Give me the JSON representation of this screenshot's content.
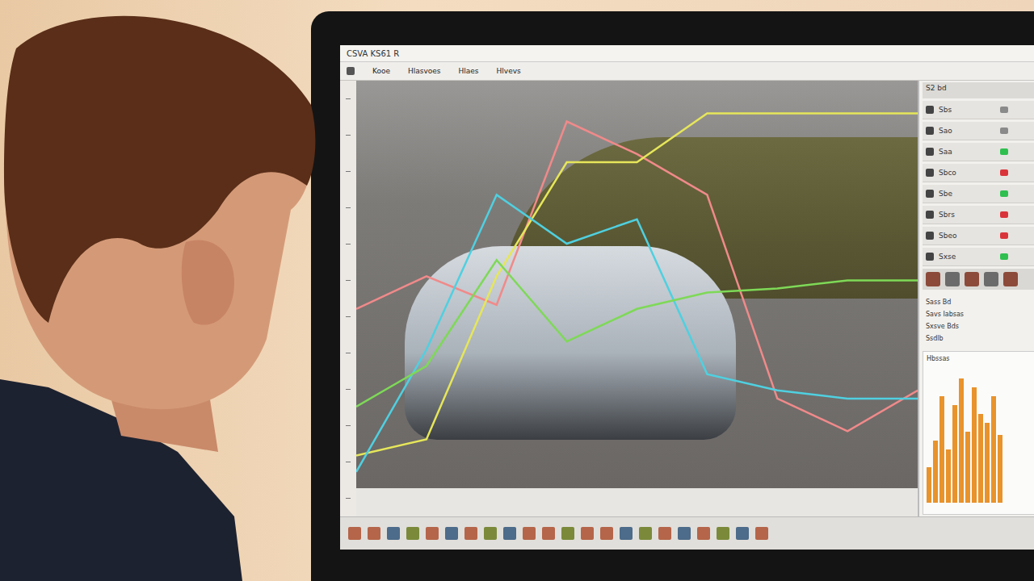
{
  "window": {
    "title": "CSVA KS61 R"
  },
  "menu": [
    {
      "label": "Kooe"
    },
    {
      "label": "Hlasvoes"
    },
    {
      "label": "Hlaes"
    },
    {
      "label": "Hlvevs"
    }
  ],
  "chart": {
    "series": [
      {
        "name": "pink",
        "color": "#f08a8a",
        "values": [
          44,
          52,
          45,
          90,
          82,
          72,
          22,
          14,
          24
        ]
      },
      {
        "name": "yellow",
        "color": "#e6e65a",
        "values": [
          8,
          12,
          52,
          80,
          80,
          92,
          92,
          92,
          92
        ]
      },
      {
        "name": "cyan",
        "color": "#4fd0e0",
        "values": [
          4,
          34,
          72,
          60,
          66,
          28,
          24,
          22,
          22
        ]
      },
      {
        "name": "green",
        "color": "#7ed957",
        "values": [
          20,
          30,
          56,
          36,
          44,
          48,
          49,
          51,
          51
        ]
      }
    ]
  },
  "panel": {
    "header": "S2 bd",
    "rows": [
      {
        "label": "Sbs",
        "color": "#8a8a8a"
      },
      {
        "label": "Sao",
        "color": "#8a8a8a"
      },
      {
        "label": "Saa",
        "color": "#2fbf4f"
      },
      {
        "label": "Sbco",
        "color": "#d9343a"
      },
      {
        "label": "Sbe",
        "color": "#2fbf4f"
      },
      {
        "label": "Sbrs",
        "color": "#d9343a"
      },
      {
        "label": "Sbeo",
        "color": "#d9343a"
      },
      {
        "label": "Sxse",
        "color": "#2fbf4f"
      }
    ],
    "notes": [
      "Sass Bd",
      "Savs Iabsas",
      "Sxsve Bds",
      "Ssdlb"
    ],
    "graph_title": "Hbssas",
    "graph_values": [
      20,
      35,
      60,
      30,
      55,
      70,
      40,
      65,
      50,
      45,
      60,
      38
    ]
  }
}
